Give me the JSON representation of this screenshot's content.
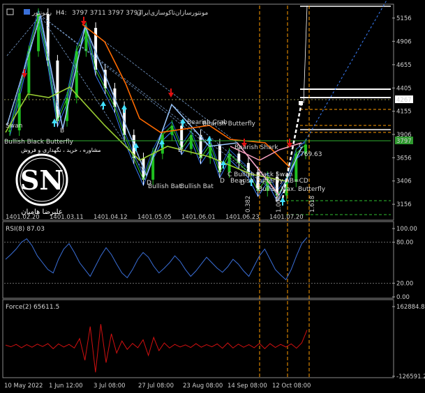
{
  "header": {
    "symbol": "مونتورسازان‌تاکوسازی‌ایران",
    "timeframe": "H4:",
    "ohlc": "3797 3711 3797 3797",
    "right_label": "ر‌مونتور"
  },
  "watermark": {
    "line1": "مشاوره ، خرید ، نگهداری و فروش",
    "logo": "SN",
    "name": "علیرضا هامیان"
  },
  "chart_data": [
    {
      "type": "candlestick",
      "title": "",
      "y_ticks": [
        "5156",
        "4906",
        "4655",
        "4405",
        "4155",
        "3906",
        "3656",
        "3406",
        "3156"
      ],
      "x_ticks": [
        "1401.02.20",
        "1401.03.11",
        "1401.04.12",
        "1401.05.05",
        "1401.06.01",
        "1401.06.23",
        "1401.07.20"
      ],
      "ylim": [
        3000,
        5290
      ],
      "price_label_current": "3797",
      "price_label_level": "4267",
      "close_path": [
        [
          "1401.02.20",
          3950
        ],
        [
          "",
          4350
        ],
        [
          "",
          4800
        ],
        [
          "",
          5200
        ],
        [
          "",
          4700
        ],
        [
          "",
          4050
        ],
        [
          "1401.03.11",
          4300
        ],
        [
          "",
          4800
        ],
        [
          "",
          5050
        ],
        [
          "",
          4600
        ],
        [
          "",
          4400
        ],
        [
          "1401.04.12",
          4200
        ],
        [
          "",
          3900
        ],
        [
          "",
          3650
        ],
        [
          "",
          3420
        ],
        [
          "",
          3700
        ],
        [
          "1401.05.05",
          3900
        ],
        [
          "",
          4000
        ],
        [
          "",
          3750
        ],
        [
          "",
          3900
        ],
        [
          "1401.06.01",
          3650
        ],
        [
          "",
          3800
        ],
        [
          "",
          3500
        ],
        [
          "",
          3700
        ],
        [
          "",
          3600
        ],
        [
          "1401.06.23",
          3500
        ],
        [
          "",
          3300
        ],
        [
          "",
          3450
        ],
        [
          "",
          3250
        ],
        [
          "1401.07.20",
          3400
        ],
        [
          "",
          3700
        ],
        [
          "",
          3797
        ]
      ],
      "annotations": [
        "Swan",
        "Bullish Black Butterfly",
        "Bullish Bat",
        "Bullish Bat",
        "Bearish Crab",
        "Bearish Butterfly",
        "Bearish Shark",
        "C Bullish Black Swan",
        "Bearish Butterfly AB=CD",
        "Bullish Max. Butterfly",
        "B",
        "B",
        "D",
        "D",
        "B",
        "C",
        "D",
        "D",
        "769.63"
      ],
      "fib_labels": [
        "0.382",
        "1.000",
        "1.618"
      ]
    },
    {
      "type": "line",
      "title": "RSI(8) 87.03",
      "ylim": [
        0,
        100
      ],
      "y_ticks": [
        "100.00",
        "80.00",
        "20.00",
        "0.00"
      ],
      "values": [
        55,
        62,
        70,
        80,
        85,
        75,
        60,
        50,
        40,
        35,
        55,
        70,
        78,
        65,
        50,
        40,
        30,
        45,
        60,
        72,
        62,
        48,
        35,
        28,
        40,
        55,
        65,
        58,
        45,
        35,
        42,
        50,
        60,
        52,
        40,
        30,
        38,
        48,
        58,
        50,
        42,
        36,
        44,
        55,
        48,
        38,
        30,
        45,
        60,
        70,
        55,
        40,
        32,
        25,
        40,
        60,
        78,
        87
      ]
    },
    {
      "type": "bar",
      "title": "Force(2) 65611.5",
      "y_ticks": [
        "162884.8",
        "-126591.2"
      ],
      "ylim": [
        -126591.2,
        162884.8
      ],
      "values": [
        3000,
        -4000,
        6000,
        -8000,
        5000,
        -6000,
        7000,
        -3000,
        9000,
        -12000,
        8000,
        -5000,
        6000,
        -9000,
        30000,
        -60000,
        80000,
        -110000,
        90000,
        -70000,
        50000,
        -30000,
        20000,
        -15000,
        10000,
        -8000,
        25000,
        -40000,
        35000,
        -20000,
        12000,
        -9000,
        6000,
        -5000,
        4000,
        -7000,
        9000,
        -6000,
        5000,
        -4000,
        8000,
        -10000,
        12000,
        -9000,
        7000,
        -6000,
        5000,
        -8000,
        10000,
        -12000,
        9000,
        -7000,
        6000,
        -5000,
        8000,
        -10000,
        12000,
        65611.5
      ]
    }
  ],
  "time_axis": [
    "10 May 2022",
    "1 Jun 12:00",
    "3 Jul 08:00",
    "27 Jul 08:00",
    "23 Aug 08:00",
    "14 Sep 08:00",
    "12 Oct 08:00"
  ],
  "colors": {
    "background": "#000000",
    "pattern_lines": "#9ec9ff",
    "resistance": "#ff6a00",
    "support": "#9acd32",
    "rsi": "#3a6fd8",
    "force": "#d01010",
    "bearish_pattern": "#f7a0c0",
    "arrow_down": "#e01010",
    "arrow_up": "#40e0ff"
  }
}
